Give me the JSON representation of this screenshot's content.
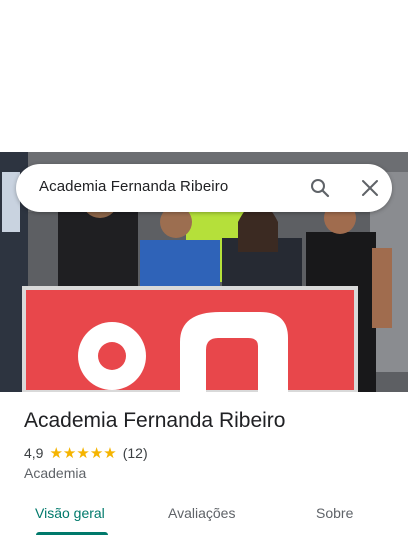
{
  "search": {
    "query": "Academia Fernanda Ribeiro"
  },
  "place": {
    "name": "Academia Fernanda Ribeiro",
    "rating": "4,9",
    "star_count": 5,
    "review_count": "(12)",
    "category": "Academia"
  },
  "tabs": [
    {
      "label": "Visão geral",
      "active": true
    },
    {
      "label": "Avaliações",
      "active": false
    },
    {
      "label": "Sobre",
      "active": false
    }
  ],
  "colors": {
    "accent": "#00796b",
    "star": "#f5b400",
    "sign": "#e8474b"
  }
}
